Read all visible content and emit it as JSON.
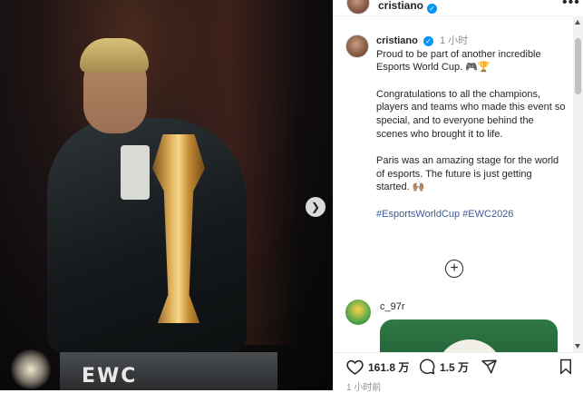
{
  "post": {
    "author": "cristiano",
    "verified": true,
    "more_label": "•••",
    "caption": {
      "username": "cristiano",
      "time": "1 小时",
      "paragraphs": [
        "Proud to be part of another incredible Esports World Cup. 🎮🏆",
        "Congratulations to all the champions, players and teams who made this event so special, and to everyone behind the scenes who brought it to life.",
        "Paris was an amazing stage for the world of esports. The future is just getting started. 🙌🏽"
      ],
      "hashtags": "#EsportsWorldCup #EWC2026"
    },
    "photo": {
      "logo_text": "EWC",
      "next_icon": "chevron-right-icon"
    },
    "add_comment_icon": "plus-circle-icon",
    "comment": {
      "username": "c_97r"
    },
    "actions": {
      "like_count": "161.8 万",
      "comment_count": "1.5 万",
      "like_icon": "heart-icon",
      "comment_icon": "comment-icon",
      "share_icon": "share-icon",
      "save_icon": "bookmark-icon"
    },
    "posted_time": "1 小时前"
  },
  "colors": {
    "link": "#3c5a99",
    "verified": "#0095f6",
    "muted": "#8e8e8e",
    "text": "#262626"
  }
}
